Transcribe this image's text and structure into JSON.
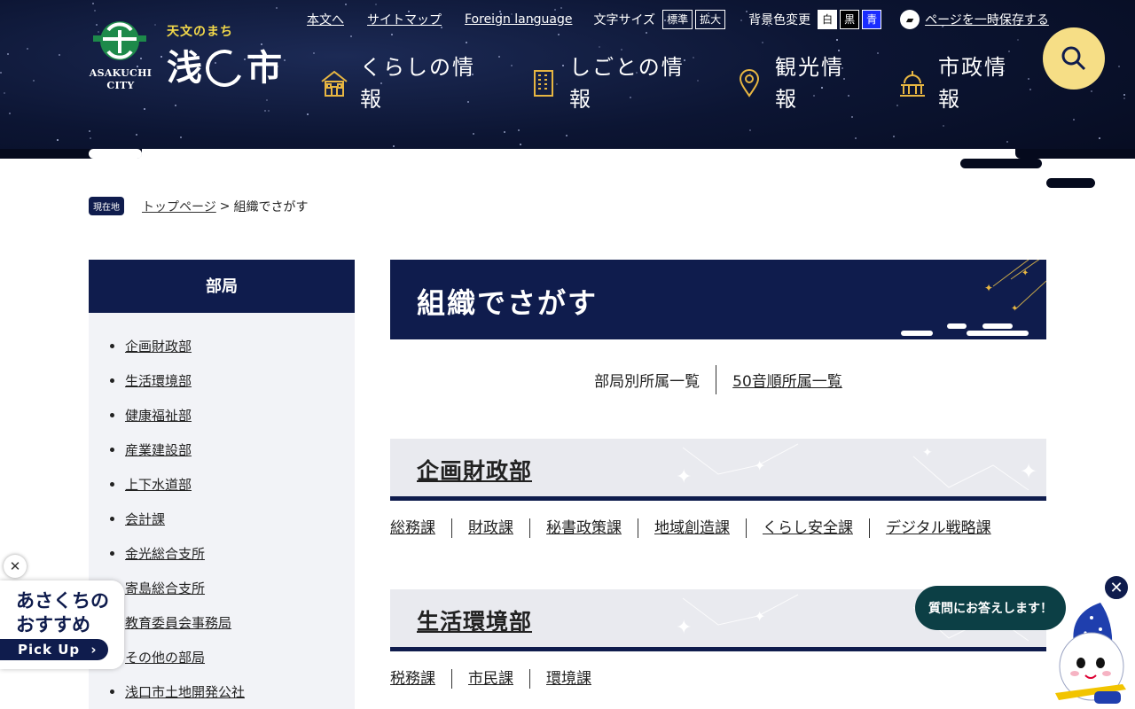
{
  "logo": {
    "tagline": "天文のまち",
    "name_left": "浅",
    "name_right": "市",
    "name_en_1": "ASAKUCHI",
    "name_en_2": "CITY"
  },
  "utility": {
    "skip": "本文へ",
    "sitemap": "サイトマップ",
    "foreign": "Foreign language",
    "font_size_label": "文字サイズ",
    "font_standard": "標準",
    "font_large": "拡大",
    "bg_label": "背景色変更",
    "bg_white": "白",
    "bg_black": "黒",
    "bg_blue": "青",
    "save_page": "ページを一時保存する"
  },
  "nav": [
    {
      "label_1": "くらしの情",
      "label_2": "報",
      "icon": "house-icon"
    },
    {
      "label_1": "しごとの情",
      "label_2": "報",
      "icon": "building-icon"
    },
    {
      "label_1": "観光情",
      "label_2": "報",
      "icon": "map-pin-icon"
    },
    {
      "label_1": "市政情",
      "label_2": "報",
      "icon": "city-hall-icon"
    }
  ],
  "search": {
    "icon": "search-icon"
  },
  "breadcrumb": {
    "badge": "現在地",
    "home": "トップページ",
    "sep": ">",
    "current": "組織でさがす"
  },
  "sidebar": {
    "title": "部局",
    "items": [
      "企画財政部",
      "生活環境部",
      "健康福祉部",
      "産業建設部",
      "上下水道部",
      "会計課",
      "金光総合支所",
      "寄島総合支所",
      "教育委員会事務局",
      "その他の部局",
      "浅口市土地開発公社"
    ]
  },
  "main": {
    "title": "組織でさがす",
    "tabs": [
      "部局別所属一覧",
      "50音順所属一覧"
    ],
    "sections": [
      {
        "title": "企画財政部",
        "links": [
          "総務課",
          "財政課",
          "秘書政策課",
          "地域創造課",
          "くらし安全課",
          "デジタル戦略課"
        ]
      },
      {
        "title": "生活環境部",
        "links": [
          "税務課",
          "市民課",
          "環境課"
        ]
      }
    ]
  },
  "pickup": {
    "line1": "あさくちの",
    "line2": "おすすめ",
    "button": "Pick Up",
    "close": "✕"
  },
  "chat": {
    "text": "質問にお答えします！",
    "close": "✕"
  },
  "colors": {
    "navy": "#0f1c4d",
    "gold": "#e7b642",
    "search_bg": "#f6de86",
    "chat_bg": "#0c3f45"
  }
}
